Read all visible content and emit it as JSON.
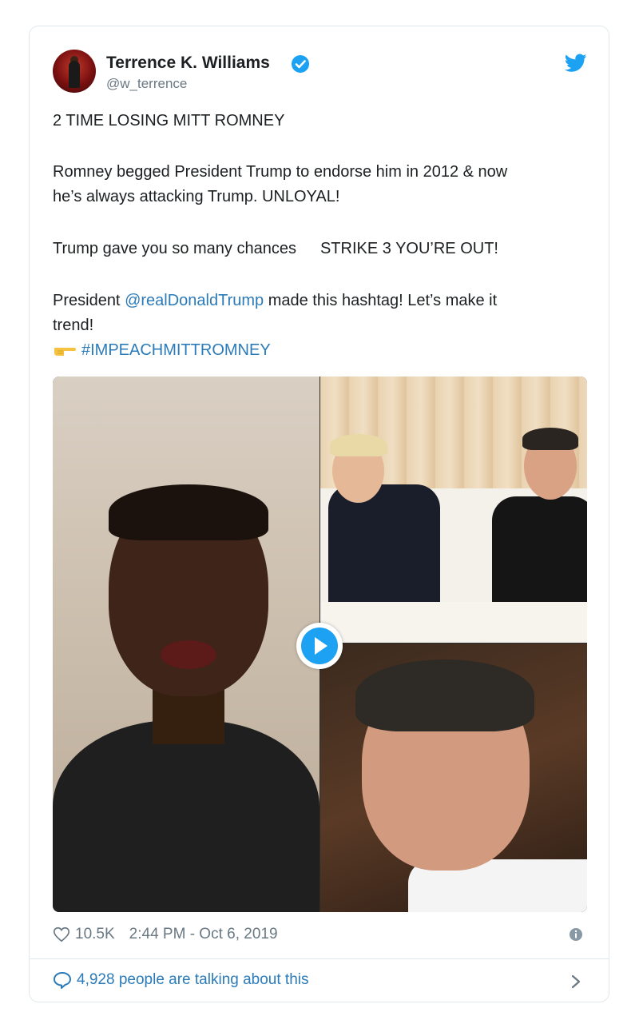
{
  "tweet": {
    "author_name": "Terrence K. Williams",
    "author_handle": "@w_terrence",
    "line1": "2 TIME LOSING MITT ROMNEY",
    "line2a": "Romney begged President Trump to endorse him in 2012 & now",
    "line2b": "he’s always attacking Trump. UNLOYAL!",
    "line3a": "Trump gave you so many chances",
    "line3b": "STRIKE 3 YOU’RE OUT!",
    "line4_prefix": "President ",
    "mention": "@realDonaldTrump",
    "line4_suffix": " made this hashtag! Let’s make it",
    "line4b": "trend!",
    "hashtag": "#IMPEACHMITTROMNEY"
  },
  "footer": {
    "likes": "10.5K",
    "timestamp": "2:44 PM - Oct 6, 2019",
    "talking": "4,928 people are talking about this"
  },
  "icons": {
    "verified": "verified-badge-icon",
    "brand": "twitter-bird-icon",
    "pointing_hand": "pointing-hand-emoji",
    "play": "play-icon",
    "heart": "heart-icon",
    "info": "info-icon",
    "reply": "speech-bubble-icon",
    "chevron": "chevron-right-icon"
  },
  "colors": {
    "link": "#2b7bb9",
    "verified": "#1da1f2",
    "muted": "#697882",
    "text": "#1c2022"
  }
}
